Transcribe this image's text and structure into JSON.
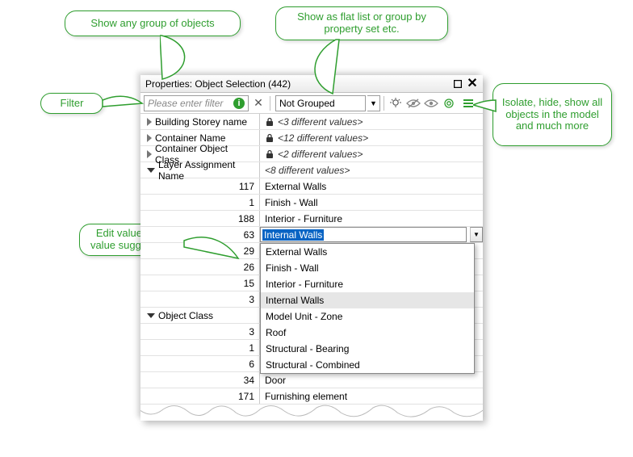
{
  "titlebar": {
    "title": "Properties: Object Selection (442)"
  },
  "toolbar": {
    "filter_placeholder": "Please enter filter",
    "group_selected": "Not Grouped"
  },
  "rows": {
    "building_storey": {
      "label": "Building Storey name",
      "value": "<3 different values>"
    },
    "container_name": {
      "label": "Container Name",
      "value": "<12 different values>"
    },
    "container_class": {
      "label": "Container Object Class",
      "value": "<2 different values>"
    },
    "layer_assign": {
      "label": "Layer Assignment Name",
      "value": "<8 different values>"
    },
    "object_class": {
      "label": "Object Class"
    }
  },
  "layer_rows": [
    {
      "count": "117",
      "value": "External Walls"
    },
    {
      "count": "1",
      "value": "Finish - Wall"
    },
    {
      "count": "188",
      "value": "Interior - Furniture"
    },
    {
      "count": "63",
      "value": "Internal Walls",
      "editing": true
    },
    {
      "count": "29",
      "value": ""
    },
    {
      "count": "26",
      "value": ""
    },
    {
      "count": "15",
      "value": ""
    },
    {
      "count": "3",
      "value": ""
    }
  ],
  "dropdown_options": [
    "External Walls",
    "Finish - Wall",
    "Interior - Furniture",
    "Internal Walls",
    "Model Unit - Zone",
    "Roof",
    "Structural - Bearing",
    "Structural - Combined"
  ],
  "objclass_rows": [
    {
      "count": "3",
      "value": ""
    },
    {
      "count": "1",
      "value": ""
    },
    {
      "count": "6",
      "value": ""
    },
    {
      "count": "34",
      "value": "Door"
    },
    {
      "count": "171",
      "value": "Furnishing element"
    }
  ],
  "callouts": {
    "group": "Show any group of objects",
    "flat": "Show as flat list or group by property set etc.",
    "filter": "Filter",
    "edit": "Edit values with value suggestions",
    "isolate": "Isolate, hide, show all objects in the model and much more"
  }
}
